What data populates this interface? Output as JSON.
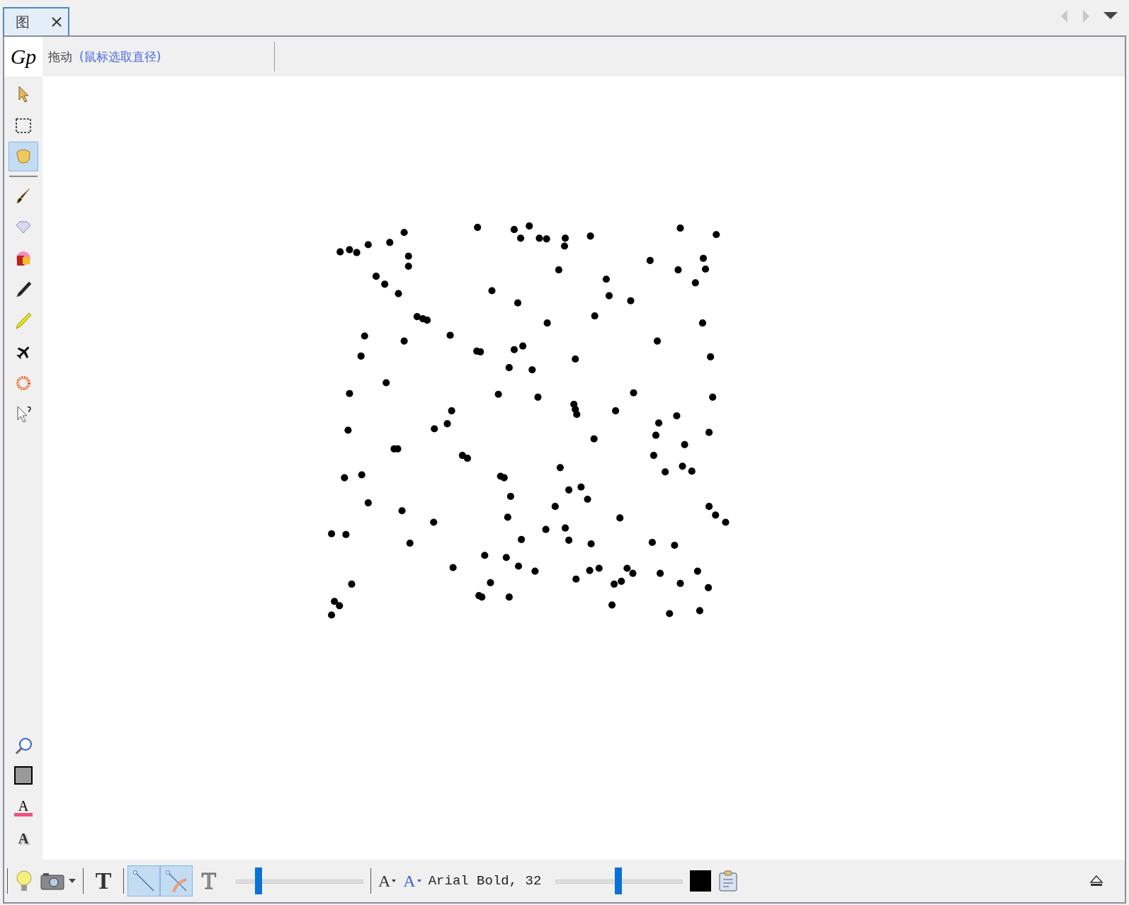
{
  "tabs": [
    {
      "label": "图",
      "selected": true
    }
  ],
  "header": {
    "logo": "Gp",
    "mode": "拖动",
    "hint": "(鼠标选取直径)"
  },
  "tools": [
    {
      "kind": "arrow",
      "selected": false
    },
    {
      "kind": "marquee",
      "selected": false
    },
    {
      "kind": "hand",
      "selected": true
    },
    {
      "kind": "sep"
    },
    {
      "kind": "brush",
      "selected": false
    },
    {
      "kind": "diamond",
      "selected": false
    },
    {
      "kind": "palette",
      "selected": false
    },
    {
      "kind": "pen",
      "selected": false
    },
    {
      "kind": "highlighter",
      "selected": false
    },
    {
      "kind": "plane",
      "selected": false
    },
    {
      "kind": "flower",
      "selected": false
    },
    {
      "kind": "helpcursor",
      "selected": false
    }
  ],
  "side_bottom": [
    {
      "kind": "zoom"
    },
    {
      "kind": "square"
    },
    {
      "kind": "textcolor",
      "label": "A"
    },
    {
      "kind": "textshadow",
      "label": "A"
    }
  ],
  "bottom_bar": [
    {
      "kind": "sep"
    },
    {
      "kind": "bulb"
    },
    {
      "kind": "camera"
    },
    {
      "kind": "sep"
    },
    {
      "kind": "bigtext",
      "label": "T",
      "selected": false
    },
    {
      "kind": "sep"
    },
    {
      "kind": "line",
      "selected": true
    },
    {
      "kind": "rainbowline",
      "selected": true
    },
    {
      "kind": "outlinetext",
      "label": "T",
      "selected": false
    },
    {
      "kind": "slider",
      "level": 0.18
    },
    {
      "kind": "sep"
    },
    {
      "kind": "fontbtn",
      "label": "A",
      "color": "#333333"
    },
    {
      "kind": "fontbtn",
      "label": "A",
      "color": "#3a62d6"
    },
    {
      "kind": "font",
      "label": "Arial Bold, 32"
    },
    {
      "kind": "slider",
      "level": 0.49
    },
    {
      "kind": "swatch",
      "color": "#000000"
    },
    {
      "kind": "clipboard"
    }
  ]
}
